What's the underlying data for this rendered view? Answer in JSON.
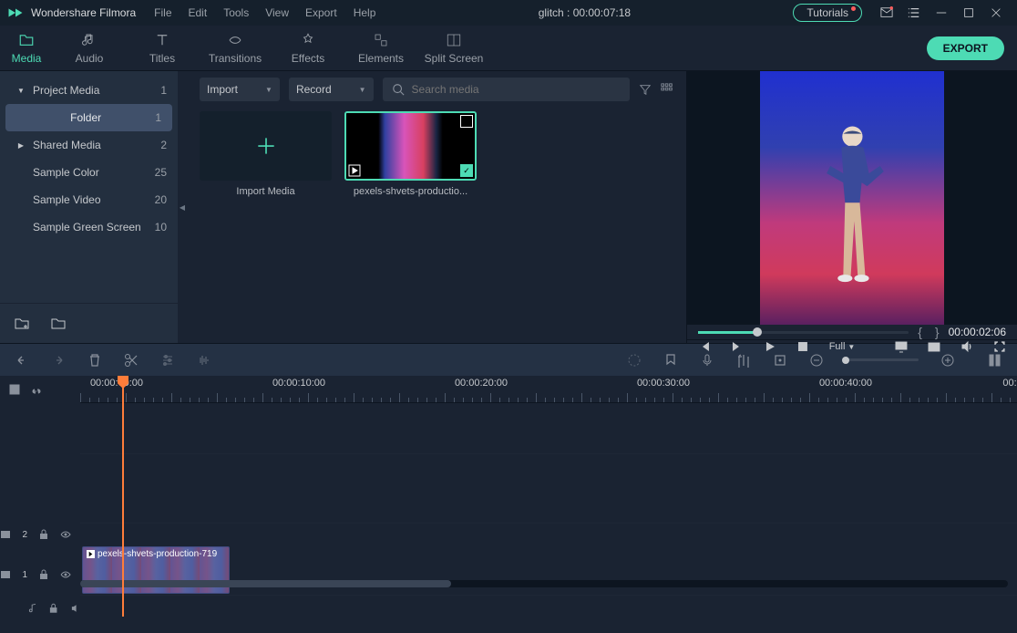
{
  "app": {
    "title": "Wondershare Filmora"
  },
  "menu": [
    "File",
    "Edit",
    "Tools",
    "View",
    "Export",
    "Help"
  ],
  "project": {
    "title": "glitch : 00:00:07:18"
  },
  "titlebar": {
    "tutorials": "Tutorials"
  },
  "ribbon": {
    "tabs": [
      {
        "label": "Media"
      },
      {
        "label": "Audio"
      },
      {
        "label": "Titles"
      },
      {
        "label": "Transitions"
      },
      {
        "label": "Effects"
      },
      {
        "label": "Elements"
      },
      {
        "label": "Split Screen"
      }
    ],
    "export": "EXPORT"
  },
  "sidebar": {
    "items": [
      {
        "label": "Project Media",
        "count": "1",
        "chev": "▼"
      },
      {
        "label": "Folder",
        "count": "1"
      },
      {
        "label": "Shared Media",
        "count": "2",
        "chev": "▶"
      },
      {
        "label": "Sample Color",
        "count": "25"
      },
      {
        "label": "Sample Video",
        "count": "20"
      },
      {
        "label": "Sample Green Screen",
        "count": "10"
      }
    ]
  },
  "media": {
    "import_label": "Import",
    "record_label": "Record",
    "search_placeholder": "Search media",
    "import_media": "Import Media",
    "clip_name": "pexels-shvets-productio..."
  },
  "preview": {
    "timecode": "00:00:02:06",
    "quality": "Full"
  },
  "timeline": {
    "ruler": [
      "00:00:00:00",
      "00:00:10:00",
      "00:00:20:00",
      "00:00:30:00",
      "00:00:40:00",
      "00:"
    ],
    "clip_label": "pexels-shvets-production-719",
    "track2": "2",
    "track1": "1"
  }
}
